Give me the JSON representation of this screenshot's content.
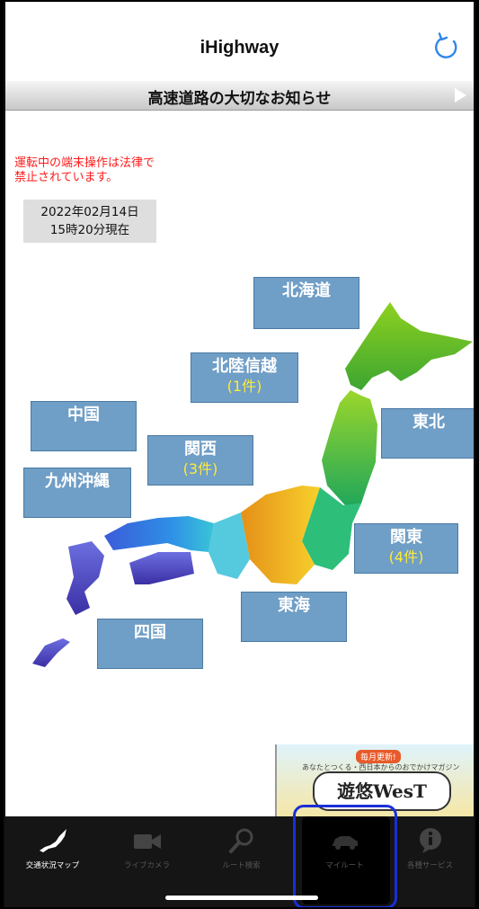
{
  "header": {
    "title": "iHighway",
    "refresh_icon": "refresh-icon"
  },
  "notice": {
    "text": "高速道路の大切なお知らせ"
  },
  "warning": "運転中の端末操作は法律で\n禁止されています。",
  "timestamp": "2022年02月14日\n15時20分現在",
  "regions": {
    "hokkaido": {
      "name": "北海道",
      "count": ""
    },
    "hokuriku": {
      "name": "北陸信越",
      "count": "(1件)"
    },
    "tohoku": {
      "name": "東北",
      "count": ""
    },
    "chugoku": {
      "name": "中国",
      "count": ""
    },
    "kansai": {
      "name": "関西",
      "count": "(3件)"
    },
    "kyushu": {
      "name": "九州沖縄",
      "count": ""
    },
    "kanto": {
      "name": "関東",
      "count": "(4件)"
    },
    "tokai": {
      "name": "東海",
      "count": ""
    },
    "shikoku": {
      "name": "四国",
      "count": ""
    }
  },
  "banner": {
    "tag": "毎月更新!",
    "sub": "あなたとつくる・西日本からのおでかけマガジン",
    "title": "遊悠WesT"
  },
  "tabs": [
    {
      "label": "交通状況マップ",
      "icon": "japan-map-icon",
      "active": true
    },
    {
      "label": "ライブカメラ",
      "icon": "video-camera-icon",
      "active": false
    },
    {
      "label": "ルート検索",
      "icon": "search-icon",
      "active": false
    },
    {
      "label": "マイルート",
      "icon": "car-icon",
      "active": false
    },
    {
      "label": "各種サービス",
      "icon": "info-icon",
      "active": false
    }
  ],
  "colors": {
    "region_box": "#6f9ec6",
    "count_text": "#ffeb3b",
    "warning_text": "#ff1a1a",
    "highlight": "#1a2fd6"
  }
}
